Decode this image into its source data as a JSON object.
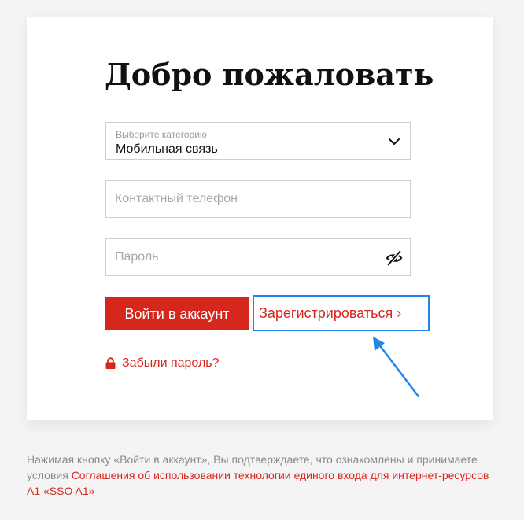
{
  "page": {
    "title": "Добро пожаловать"
  },
  "form": {
    "category": {
      "label": "Выберите категорию",
      "value": "Мобильная связь",
      "icon": "chevron-down-icon"
    },
    "phone": {
      "placeholder": "Контактный телефон",
      "value": ""
    },
    "password": {
      "placeholder": "Пароль",
      "value": "",
      "icon": "eye-off-icon"
    },
    "login_button": "Войти в аккаунт",
    "register_link": "Зарегистрироваться ›",
    "forgot_link": "Забыли пароль?",
    "forgot_icon": "lock-icon"
  },
  "footer": {
    "text": "Нажимая кнопку «Войти в аккаунт», Вы подтверждаете, что ознакомлены и принимаете условия ",
    "link": "Соглашения об использовании технологии единого входа для интернет-ресурсов A1 «SSO A1»"
  },
  "colors": {
    "accent": "#d6271d",
    "highlight": "#2186e8",
    "background": "#f4f4f4",
    "card": "#ffffff"
  }
}
